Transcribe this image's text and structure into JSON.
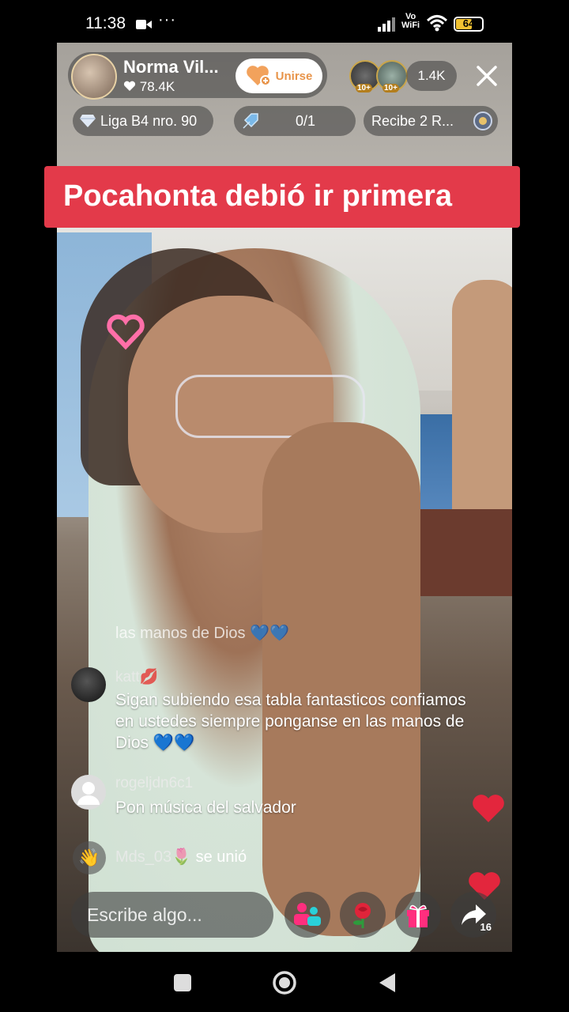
{
  "status_bar": {
    "time": "11:38",
    "dots": "···",
    "network_label_top": "Vo",
    "network_label_bottom": "WiFi",
    "battery": "64",
    "battery_level": 0.64
  },
  "header": {
    "host_name": "Norma Vil...",
    "host_likes": "78.4K",
    "join_label": "Unirse",
    "viewer_badges": [
      "10+",
      "10+"
    ],
    "viewer_count": "1.4K"
  },
  "chips": {
    "league": "Liga B4 nro. 90",
    "task_progress": "0/1",
    "reward": "Recibe 2 R..."
  },
  "caption": "Pocahonta debió ir primera",
  "chat": {
    "faded_line": "las manos de Dios 💙💙",
    "messages": [
      {
        "user": "katt💋",
        "text": "Sigan subiendo esa tabla fantasticos confiamos en ustedes siempre ponganse en las manos de Dios 💙💙"
      },
      {
        "user": "rogeljdn6c1",
        "text": "Pon música del salvador"
      }
    ],
    "join_event": {
      "user": "Mds_03🌷",
      "text": "se unió"
    }
  },
  "bottom_bar": {
    "input_placeholder": "Escribe algo...",
    "share_count": "16"
  },
  "colors": {
    "caption_bg": "#e33a4a",
    "join_text": "#e8944a",
    "heart": "#e3263d",
    "accent_pink": "#ff2e7e"
  },
  "icons": [
    "video-camera-icon",
    "signal-icon",
    "wifi-icon",
    "battery-icon",
    "heart-icon",
    "join-heart-icon",
    "close-icon",
    "diamond-icon",
    "rocket-icon",
    "reward-badge-icon",
    "wave-hand-icon",
    "guests-icon",
    "rose-icon",
    "gift-icon",
    "share-icon",
    "square-nav-icon",
    "circle-nav-icon",
    "back-nav-icon"
  ]
}
